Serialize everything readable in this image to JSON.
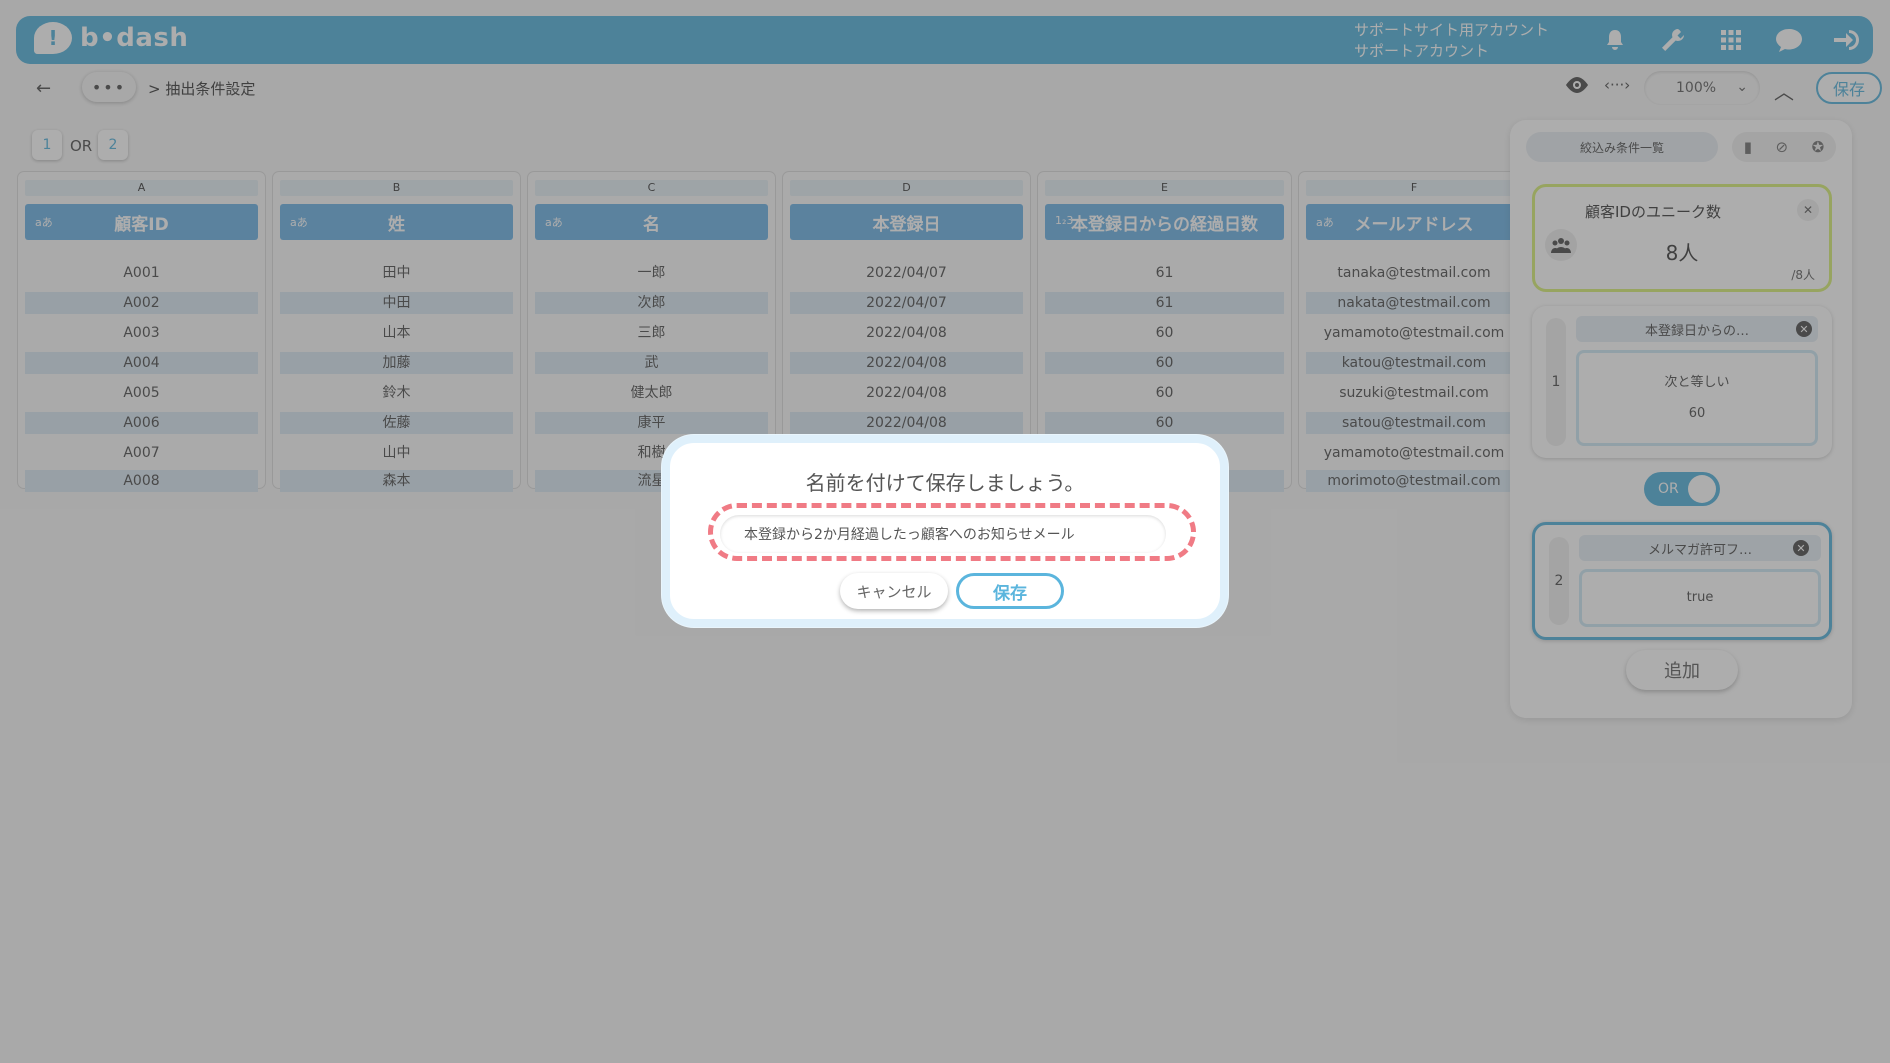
{
  "header": {
    "logo_text": "b•dash",
    "account_line1": "サポートサイト用アカウント",
    "account_line2": "サポートアカウント",
    "icons": [
      "bell-icon",
      "wrench-icon",
      "grid-icon",
      "chat-icon",
      "logout-icon"
    ]
  },
  "toolbar": {
    "back_icon": "←",
    "more_label": "•••",
    "breadcrumb": "> 抽出条件設定",
    "zoom": "100%",
    "save_label": "保存"
  },
  "groups": {
    "tab1": "1",
    "separator": "OR",
    "tab2": "2"
  },
  "table": {
    "columns": [
      {
        "letter": "A",
        "type": "aあ",
        "header": "顧客ID",
        "cells": [
          "A001",
          "A002",
          "A003",
          "A004",
          "A005",
          "A006",
          "A007",
          "A008"
        ]
      },
      {
        "letter": "B",
        "type": "aあ",
        "header": "姓",
        "cells": [
          "田中",
          "中田",
          "山本",
          "加藤",
          "鈴木",
          "佐藤",
          "山中",
          "森本"
        ]
      },
      {
        "letter": "C",
        "type": "aあ",
        "header": "名",
        "cells": [
          "一郎",
          "次郎",
          "三郎",
          "武",
          "健太郎",
          "康平",
          "和樹",
          "流星"
        ]
      },
      {
        "letter": "D",
        "type": "",
        "header": "本登録日",
        "cells": [
          "2022/04/07",
          "2022/04/07",
          "2022/04/08",
          "2022/04/08",
          "2022/04/08",
          "2022/04/08",
          "",
          ""
        ]
      },
      {
        "letter": "E",
        "type": "1₂3",
        "header": "本登録日からの経過日数",
        "cells": [
          "61",
          "61",
          "60",
          "60",
          "60",
          "60",
          "",
          ""
        ]
      },
      {
        "letter": "F",
        "type": "aあ",
        "header": "メールアドレス",
        "cells": [
          "tanaka@testmail.com",
          "nakata@testmail.com",
          "yamamoto@testmail.com",
          "katou@testmail.com",
          "suzuki@testmail.com",
          "satou@testmail.com",
          "yamamoto@testmail.com",
          "morimoto@testmail.com"
        ]
      }
    ]
  },
  "panel": {
    "tab_label": "絞込み条件一覧",
    "unique_title": "顧客IDのユニーク数",
    "unique_value": "8人",
    "unique_total": "/8人",
    "cond1": {
      "num": "1",
      "title": "本登録日からの…",
      "op": "次と等しい",
      "value": "60"
    },
    "or_label": "OR",
    "cond2": {
      "num": "2",
      "title": "メルマガ許可フ…",
      "value": "true"
    },
    "add_label": "追加"
  },
  "modal": {
    "title": "名前を付けて保存しましょう。",
    "input_value": "本登録から2か月経過したっ顧客へのお知らせメール",
    "cancel_label": "キャンセル",
    "save_label": "保存"
  }
}
